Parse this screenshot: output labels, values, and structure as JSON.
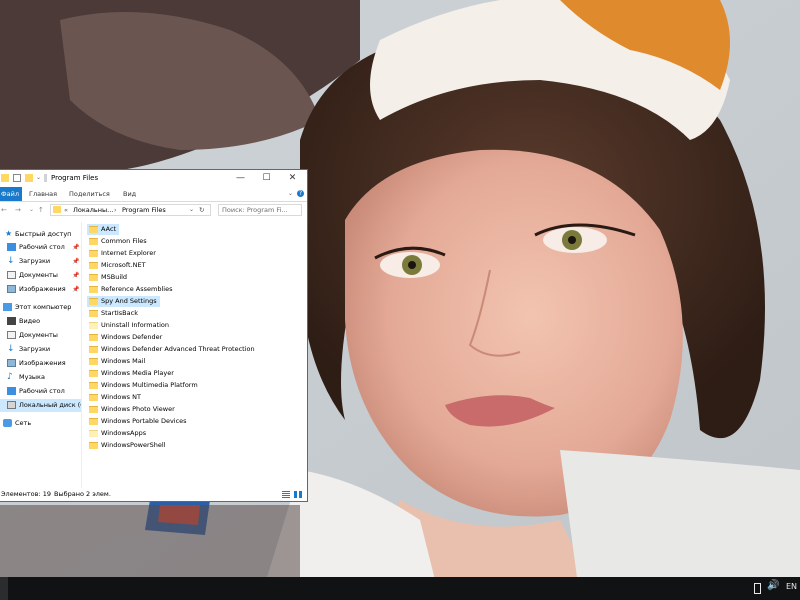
{
  "window": {
    "title": "Program Files",
    "minimize_glyph": "—",
    "maximize_glyph": "☐",
    "close_glyph": "✕"
  },
  "ribbon": {
    "tabs": [
      "Файл",
      "Главная",
      "Поделиться",
      "Вид"
    ],
    "expand_glyph": "⌄",
    "help_glyph": "?"
  },
  "navigation": {
    "back_glyph": "←",
    "forward_glyph": "→",
    "recent_glyph": "⌄",
    "up_glyph": "↑",
    "address": {
      "overflow_glyph": "«",
      "segments": [
        "Локальны...",
        "Program Files"
      ],
      "separator": "›",
      "dropdown_glyph": "⌄",
      "refresh_glyph": "↻"
    },
    "search_placeholder": "Поиск: Program Fi..."
  },
  "nav_pane": {
    "quick_access": {
      "label": "Быстрый доступ",
      "items": [
        {
          "label": "Рабочий стол",
          "icon": "desktop-icon",
          "pinned": true
        },
        {
          "label": "Загрузки",
          "icon": "downloads-icon",
          "pinned": true
        },
        {
          "label": "Документы",
          "icon": "documents-icon",
          "pinned": true
        },
        {
          "label": "Изображения",
          "icon": "pictures-icon",
          "pinned": true
        }
      ]
    },
    "this_pc": {
      "label": "Этот компьютер",
      "items": [
        {
          "label": "Видео",
          "icon": "videos-icon"
        },
        {
          "label": "Документы",
          "icon": "documents-icon"
        },
        {
          "label": "Загрузки",
          "icon": "downloads-icon"
        },
        {
          "label": "Изображения",
          "icon": "pictures-icon"
        },
        {
          "label": "Музыка",
          "icon": "music-icon"
        },
        {
          "label": "Рабочий стол",
          "icon": "desktop-icon"
        },
        {
          "label": "Локальный диск (C",
          "icon": "drive-icon",
          "selected": true
        }
      ]
    },
    "network": {
      "label": "Сеть",
      "icon": "network-icon"
    },
    "pin_glyph": "📌"
  },
  "files": [
    {
      "name": "AAct",
      "selected": true,
      "light": false
    },
    {
      "name": "Common Files",
      "selected": false,
      "light": false
    },
    {
      "name": "Internet Explorer",
      "selected": false,
      "light": false
    },
    {
      "name": "Microsoft.NET",
      "selected": false,
      "light": false
    },
    {
      "name": "MSBuild",
      "selected": false,
      "light": false
    },
    {
      "name": "Reference Assemblies",
      "selected": false,
      "light": false
    },
    {
      "name": "Spy And Settings",
      "selected": true,
      "light": false
    },
    {
      "name": "StartIsBack",
      "selected": false,
      "light": false
    },
    {
      "name": "Uninstall Information",
      "selected": false,
      "light": true
    },
    {
      "name": "Windows Defender",
      "selected": false,
      "light": false
    },
    {
      "name": "Windows Defender Advanced Threat Protection",
      "selected": false,
      "light": false
    },
    {
      "name": "Windows Mail",
      "selected": false,
      "light": false
    },
    {
      "name": "Windows Media Player",
      "selected": false,
      "light": false
    },
    {
      "name": "Windows Multimedia Platform",
      "selected": false,
      "light": false
    },
    {
      "name": "Windows NT",
      "selected": false,
      "light": false
    },
    {
      "name": "Windows Photo Viewer",
      "selected": false,
      "light": false
    },
    {
      "name": "Windows Portable Devices",
      "selected": false,
      "light": false
    },
    {
      "name": "WindowsApps",
      "selected": false,
      "light": true
    },
    {
      "name": "WindowsPowerShell",
      "selected": false,
      "light": false
    }
  ],
  "status": {
    "item_count": "Элементов: 19",
    "selected_count": "Выбрано 2 элем."
  },
  "taskbar": {
    "tray_language": "EN",
    "tray_icons": [
      "usb-icon",
      "volume-icon"
    ]
  },
  "colors": {
    "accent": "#1979ca",
    "selection": "#cce8ff",
    "folder": "#ffd863",
    "taskbar": "#101214"
  }
}
